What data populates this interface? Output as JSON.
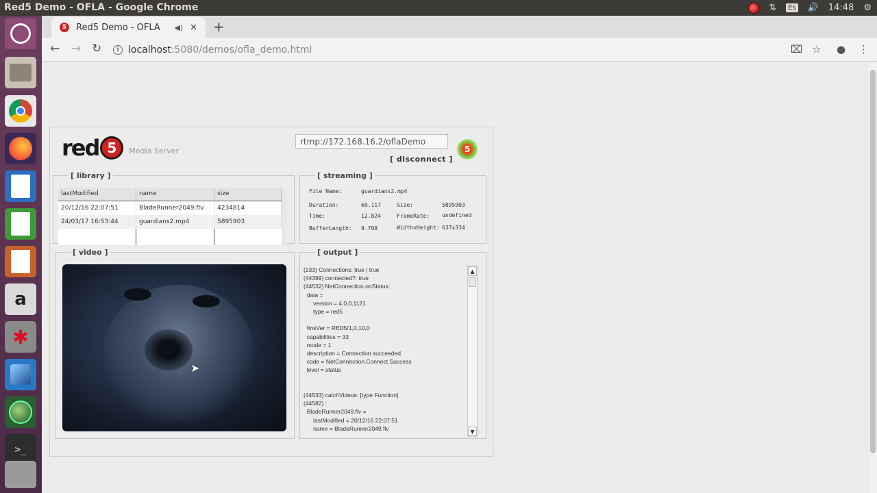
{
  "window": {
    "title": "Red5 Demo - OFLA - Google Chrome"
  },
  "tray": {
    "keyboard": "Es",
    "time": "14:48"
  },
  "browser": {
    "tab_title": "Red5 Demo - OFLA",
    "favicon_text": "5",
    "new_tab": "+",
    "url_host": "localhost",
    "url_path": ":5080/demos/ofla_demo.html"
  },
  "app": {
    "logo_text": "red",
    "logo_five": "5",
    "media_server": "Media Server",
    "rtmp_url": "rtmp://172.168.16.2/oflaDemo",
    "disconnect": "[ disconnect ]",
    "status_led": "5",
    "library": {
      "legend": "[ library ]",
      "headers": [
        "lastModified",
        "name",
        "size"
      ],
      "rows": [
        [
          "20/12/16 22:07:51",
          "BladeRunner2049.flv",
          "4234814"
        ],
        [
          "24/03/17 16:53:44",
          "guardians2.mp4",
          "5895903"
        ]
      ]
    },
    "streaming": {
      "legend": "[ streaming ]",
      "file_name_label": "File Name:",
      "file_name": "guardians2.mp4",
      "duration_label": "Duration:",
      "duration": "60.117",
      "size_label": "Size:",
      "size": "5895903",
      "time_label": "Time:",
      "time": "12.824",
      "framerate_label": "FrameRate:",
      "framerate": "undefined",
      "bufferlength_label": "BufferLength:",
      "bufferlength": "9.708",
      "wh_label": "WidthxHeight:",
      "wh": "637x334"
    },
    "video": {
      "legend": "[ video ]"
    },
    "output": {
      "legend": "[ output ]",
      "log": "(233) Connections: true | true\n(44399) connected?: true\n(44532) NetConnection.onStatus:\n  data =\n      version = 4,0,0,1121\n      type = red5\n\n  fmsVer = RED5/1,0,10,0\n  capabilities = 33\n  mode = 1\n  description = Connection succeeded.\n  code = NetConnection.Connect.Success\n  level = status\n\n\n(44533) catchVideos: [type Function]\n(44582) :\n  BladeRunner2049.flv =\n      lastModified = 20/12/16 22:07:51\n      name = BladeRunner2049.flv"
    }
  }
}
